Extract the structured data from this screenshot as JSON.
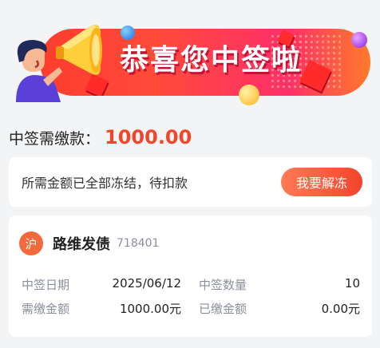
{
  "banner": {
    "title": "恭喜您中签啦",
    "colors": {
      "start": "#ff3d2e",
      "end": "#ff7a2a"
    }
  },
  "payment": {
    "label": "中签需缴款：",
    "amount": "1000.00",
    "accent_color": "#f0462a"
  },
  "notice": {
    "text": "所需金额已全部冻结，待扣款",
    "button_label": "我要解冻"
  },
  "stock": {
    "market_badge": "沪",
    "name": "路维发债",
    "code": "718401",
    "details": {
      "win_date_label": "中签日期",
      "win_date_value": "2025/06/12",
      "win_count_label": "中签数量",
      "win_count_value": "10",
      "due_label": "需缴金额",
      "due_value": "1000.00元",
      "paid_label": "已缴金额",
      "paid_value": "0.00元"
    }
  },
  "icons": [
    "megaphone-icon",
    "person-illustration"
  ]
}
